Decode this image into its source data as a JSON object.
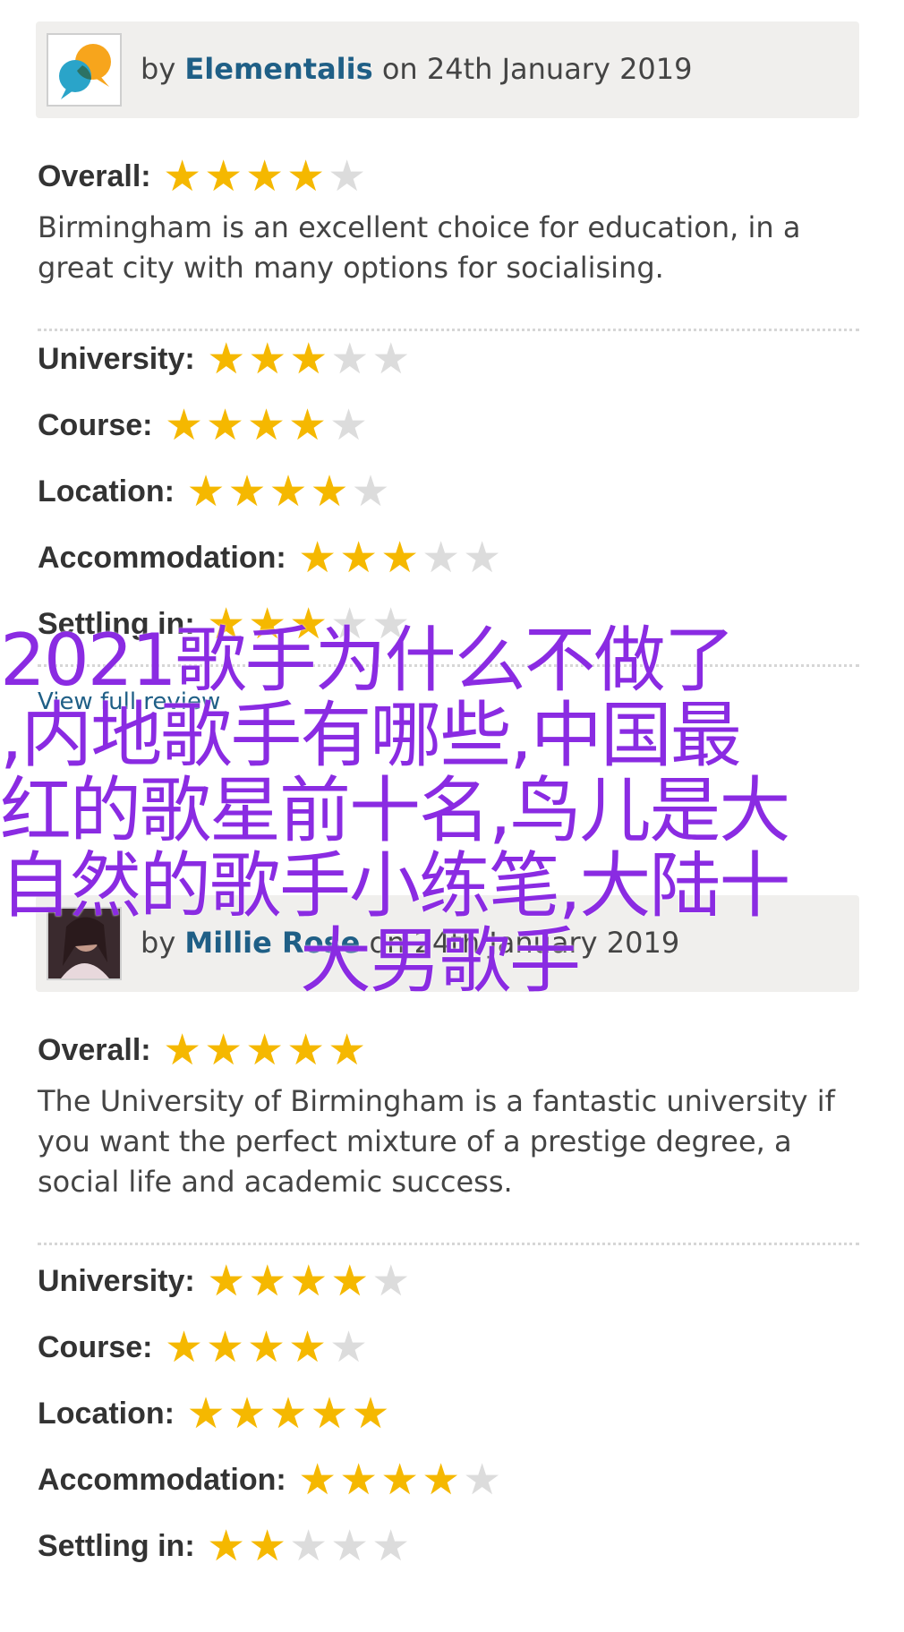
{
  "reviews": [
    {
      "by": "by",
      "author": "Elementalis",
      "date": "on 24th January 2019",
      "overall_label": "Overall:",
      "overall_stars": 4,
      "text": "Birmingham is an excellent choice for education, in a great city with many options for socialising.",
      "ratings": [
        {
          "label": "University:",
          "stars": 3
        },
        {
          "label": "Course:",
          "stars": 4
        },
        {
          "label": "Location:",
          "stars": 4
        },
        {
          "label": "Accommodation:",
          "stars": 3
        },
        {
          "label": "Settling in:",
          "stars": 3
        }
      ],
      "view_link": "View full review"
    },
    {
      "by": "by",
      "author": "Millie Rose",
      "date": "on 24th January 2019",
      "overall_label": "Overall:",
      "overall_stars": 5,
      "text": "The University of Birmingham is a fantastic university if you want the perfect mixture of a prestige degree, a social life and academic success.",
      "ratings": [
        {
          "label": "University:",
          "stars": 4
        },
        {
          "label": "Course:",
          "stars": 4
        },
        {
          "label": "Location:",
          "stars": 5
        },
        {
          "label": "Accommodation:",
          "stars": 4
        },
        {
          "label": "Settling in:",
          "stars": 2
        }
      ]
    }
  ],
  "overlay_lines": [
    "2021歌手为什么不做了",
    ",内地歌手有哪些,中国最",
    "红的歌星前十名,鸟儿是大",
    "自然的歌手小练笔,大陆十",
    "大男歌手"
  ],
  "colors": {
    "star_on": "#f5b800",
    "star_off": "#dcdcdc",
    "author_link": "#1f5f86",
    "overlay_text": "#8a2be2"
  },
  "icons": {
    "star": "★"
  }
}
